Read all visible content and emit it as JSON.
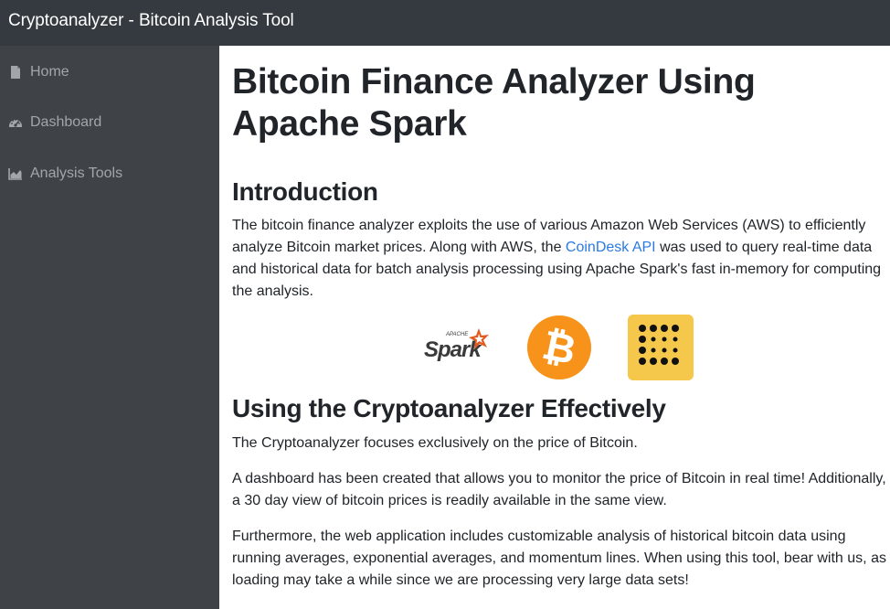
{
  "app": {
    "title": "Cryptoanalyzer - Bitcoin Analysis Tool"
  },
  "sidebar": {
    "items": [
      {
        "label": "Home",
        "icon": "file-icon"
      },
      {
        "label": "Dashboard",
        "icon": "gauge-icon"
      },
      {
        "label": "Analysis Tools",
        "icon": "area-chart-icon"
      }
    ]
  },
  "main": {
    "title": "Bitcoin Finance Analyzer Using Apache Spark",
    "intro": {
      "heading": "Introduction",
      "text_before_link": "The bitcoin finance analyzer exploits the use of various Amazon Web Services (AWS) to efficiently analyze Bitcoin market prices. Along with AWS, the ",
      "link_text": "CoinDesk API",
      "text_after_link": " was used to query real-time data and historical data for batch analysis processing using Apache Spark's fast in-memory for computing the analysis."
    },
    "logos": {
      "spark_top": "APACHE",
      "spark_word": "Spark",
      "bitcoin_symbol": "₿"
    },
    "usage": {
      "heading": "Using the Cryptoanalyzer Effectively",
      "p1": "The Cryptoanalyzer focuses exclusively on the price of Bitcoin.",
      "p2": "A dashboard has been created that allows you to monitor the price of Bitcoin in real time! Additionally, a 30 day view of bitcoin prices is readily available in the same view.",
      "p3": "Furthermore, the web application includes customizable analysis of historical bitcoin data using running averages, exponential averages, and momentum lines. When using this tool, bear with us, as loading may take a while since we are processing very large data sets!"
    }
  },
  "colors": {
    "topbar": "#343a40",
    "sidebar": "#3f4347",
    "nav_text": "#a2a6ab",
    "link": "#2a7ae2",
    "bitcoin_orange": "#f7931a",
    "coindesk_yellow": "#f5c84b",
    "spark_orange": "#e25a1c"
  }
}
